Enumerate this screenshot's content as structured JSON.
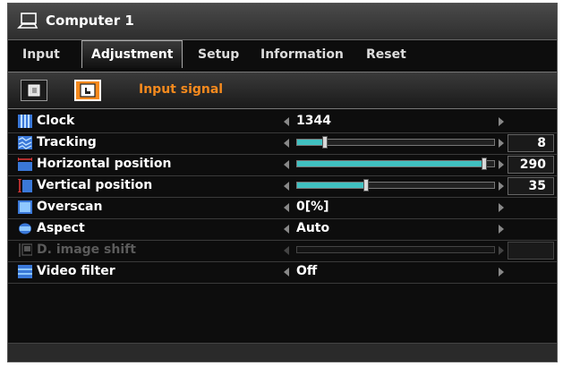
{
  "title": {
    "text": "Computer 1",
    "icon": "computer-icon"
  },
  "tabs": [
    {
      "label": "Input",
      "active": false
    },
    {
      "label": "Adjustment",
      "active": true
    },
    {
      "label": "Setup",
      "active": false
    },
    {
      "label": "Information",
      "active": false
    },
    {
      "label": "Reset",
      "active": false
    }
  ],
  "subbar": {
    "title": "Input signal",
    "accent": "#f58a1e"
  },
  "rows": [
    {
      "label": "Clock",
      "icon": "clock-icon",
      "value": "1344",
      "type": "value",
      "enabled": true
    },
    {
      "label": "Tracking",
      "icon": "tracking-icon",
      "value": "8",
      "level": 0.14,
      "type": "slider",
      "enabled": true
    },
    {
      "label": "Horizontal position",
      "icon": "horizontal-position-icon",
      "value": "290",
      "level": 0.95,
      "type": "slider",
      "enabled": true
    },
    {
      "label": "Vertical position",
      "icon": "vertical-position-icon",
      "value": "35",
      "level": 0.35,
      "type": "slider",
      "enabled": true
    },
    {
      "label": "Overscan",
      "icon": "overscan-icon",
      "value": "0[%]",
      "type": "value",
      "enabled": true
    },
    {
      "label": "Aspect",
      "icon": "aspect-icon",
      "value": "Auto",
      "type": "value",
      "enabled": true
    },
    {
      "label": "D. image shift",
      "icon": "image-shift-icon",
      "value": "",
      "level": 0,
      "type": "slider",
      "enabled": false
    },
    {
      "label": "Video filter",
      "icon": "video-filter-icon",
      "value": "Off",
      "type": "value",
      "enabled": true
    }
  ],
  "colors": {
    "slider_fill": "#40c0c0",
    "icon_blue": "#3a78d8",
    "background": "#0d0d0d"
  }
}
